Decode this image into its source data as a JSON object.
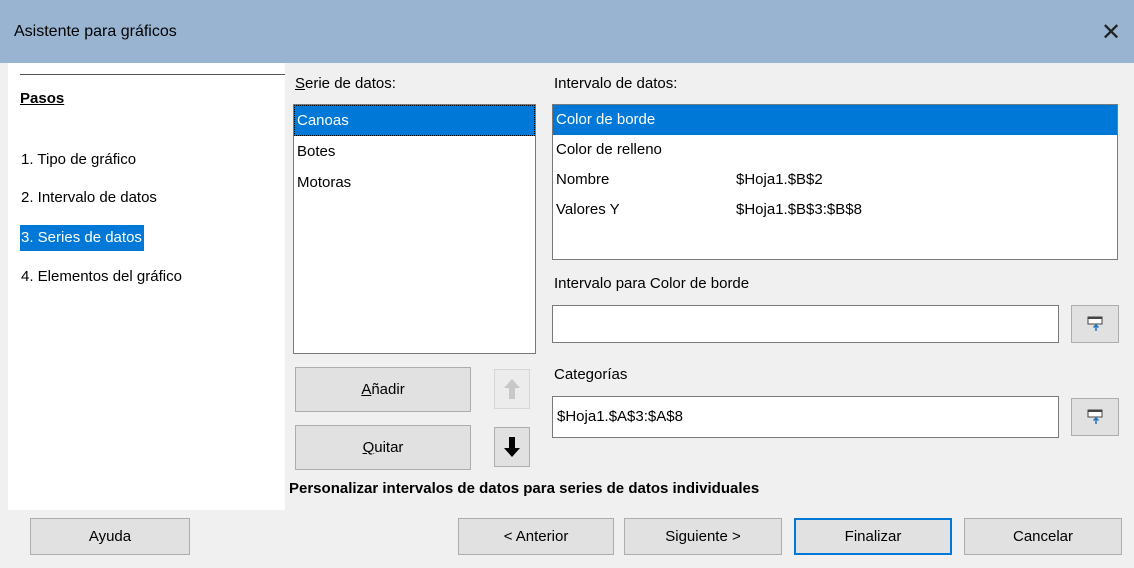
{
  "window": {
    "title": "Asistente para gráficos"
  },
  "sidebar": {
    "title": "Pasos",
    "steps": [
      {
        "label": "1. Tipo de gráfico"
      },
      {
        "label": "2. Intervalo de datos"
      },
      {
        "label": "3. Series de datos",
        "active": true
      },
      {
        "label": "4. Elementos del gráfico"
      }
    ]
  },
  "series": {
    "label": "Serie de datos:",
    "items": [
      {
        "label": "Canoas",
        "selected": true
      },
      {
        "label": "Botes"
      },
      {
        "label": "Motoras"
      }
    ],
    "add_button": "Añadir",
    "remove_button": "Quitar"
  },
  "data_ranges": {
    "label": "Intervalo de datos:",
    "rows": [
      {
        "name": "Color de borde",
        "value": "",
        "selected": true
      },
      {
        "name": "Color de relleno",
        "value": ""
      },
      {
        "name": "Nombre",
        "value": "$Hoja1.$B$2"
      },
      {
        "name": "Valores Y",
        "value": "$Hoja1.$B$3:$B$8"
      }
    ]
  },
  "range_for": {
    "label": "Intervalo para Color de borde",
    "value": ""
  },
  "categories": {
    "label": "Categorías",
    "value": "$Hoja1.$A$3:$A$8"
  },
  "hint": "Personalizar intervalos de datos para series de datos individuales",
  "footer": {
    "help": "Ayuda",
    "back": "< Anterior",
    "next": "Siguiente >",
    "finish": "Finalizar",
    "cancel": "Cancelar"
  },
  "colors": {
    "titlebar": "#99b4d1",
    "selection": "#0078d7",
    "dialog_bg": "#f0f0f0"
  },
  "icons": {
    "close": "close-icon",
    "move_up": "arrow-up-icon",
    "move_down": "arrow-down-icon",
    "shrink": "shrink-range-icon"
  }
}
